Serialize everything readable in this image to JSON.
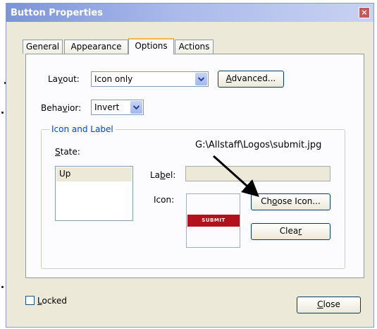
{
  "window": {
    "title": "Button Properties",
    "close_glyph": "×"
  },
  "tabs": [
    {
      "label": "General",
      "active": false
    },
    {
      "label": "Appearance",
      "active": false
    },
    {
      "label": "Options",
      "active": true
    },
    {
      "label": "Actions",
      "active": false
    }
  ],
  "options": {
    "layout_label": "Layout:",
    "layout_value": "Icon only",
    "advanced_button": "Advanced...",
    "behavior_label": "Behavior:",
    "behavior_value": "Invert"
  },
  "icon_and_label": {
    "group_title": "Icon and Label",
    "state_label": "State:",
    "states": [
      "Up"
    ],
    "label_label": "Label:",
    "label_value": "",
    "icon_label": "Icon:",
    "icon_image_text": "SUBMIT",
    "choose_icon_button": "Choose Icon...",
    "clear_button": "Clear"
  },
  "annotation": {
    "path_text": "G:\\Allstaff\\Logos\\submit.jpg"
  },
  "footer": {
    "locked_label": "Locked",
    "locked_checked": false,
    "close_button": "Close"
  },
  "colors": {
    "titlebar_start": "#7c93d8",
    "dialog_bg": "#ece9d8",
    "group_title": "#0046d5",
    "submit_red": "#b3121d"
  }
}
